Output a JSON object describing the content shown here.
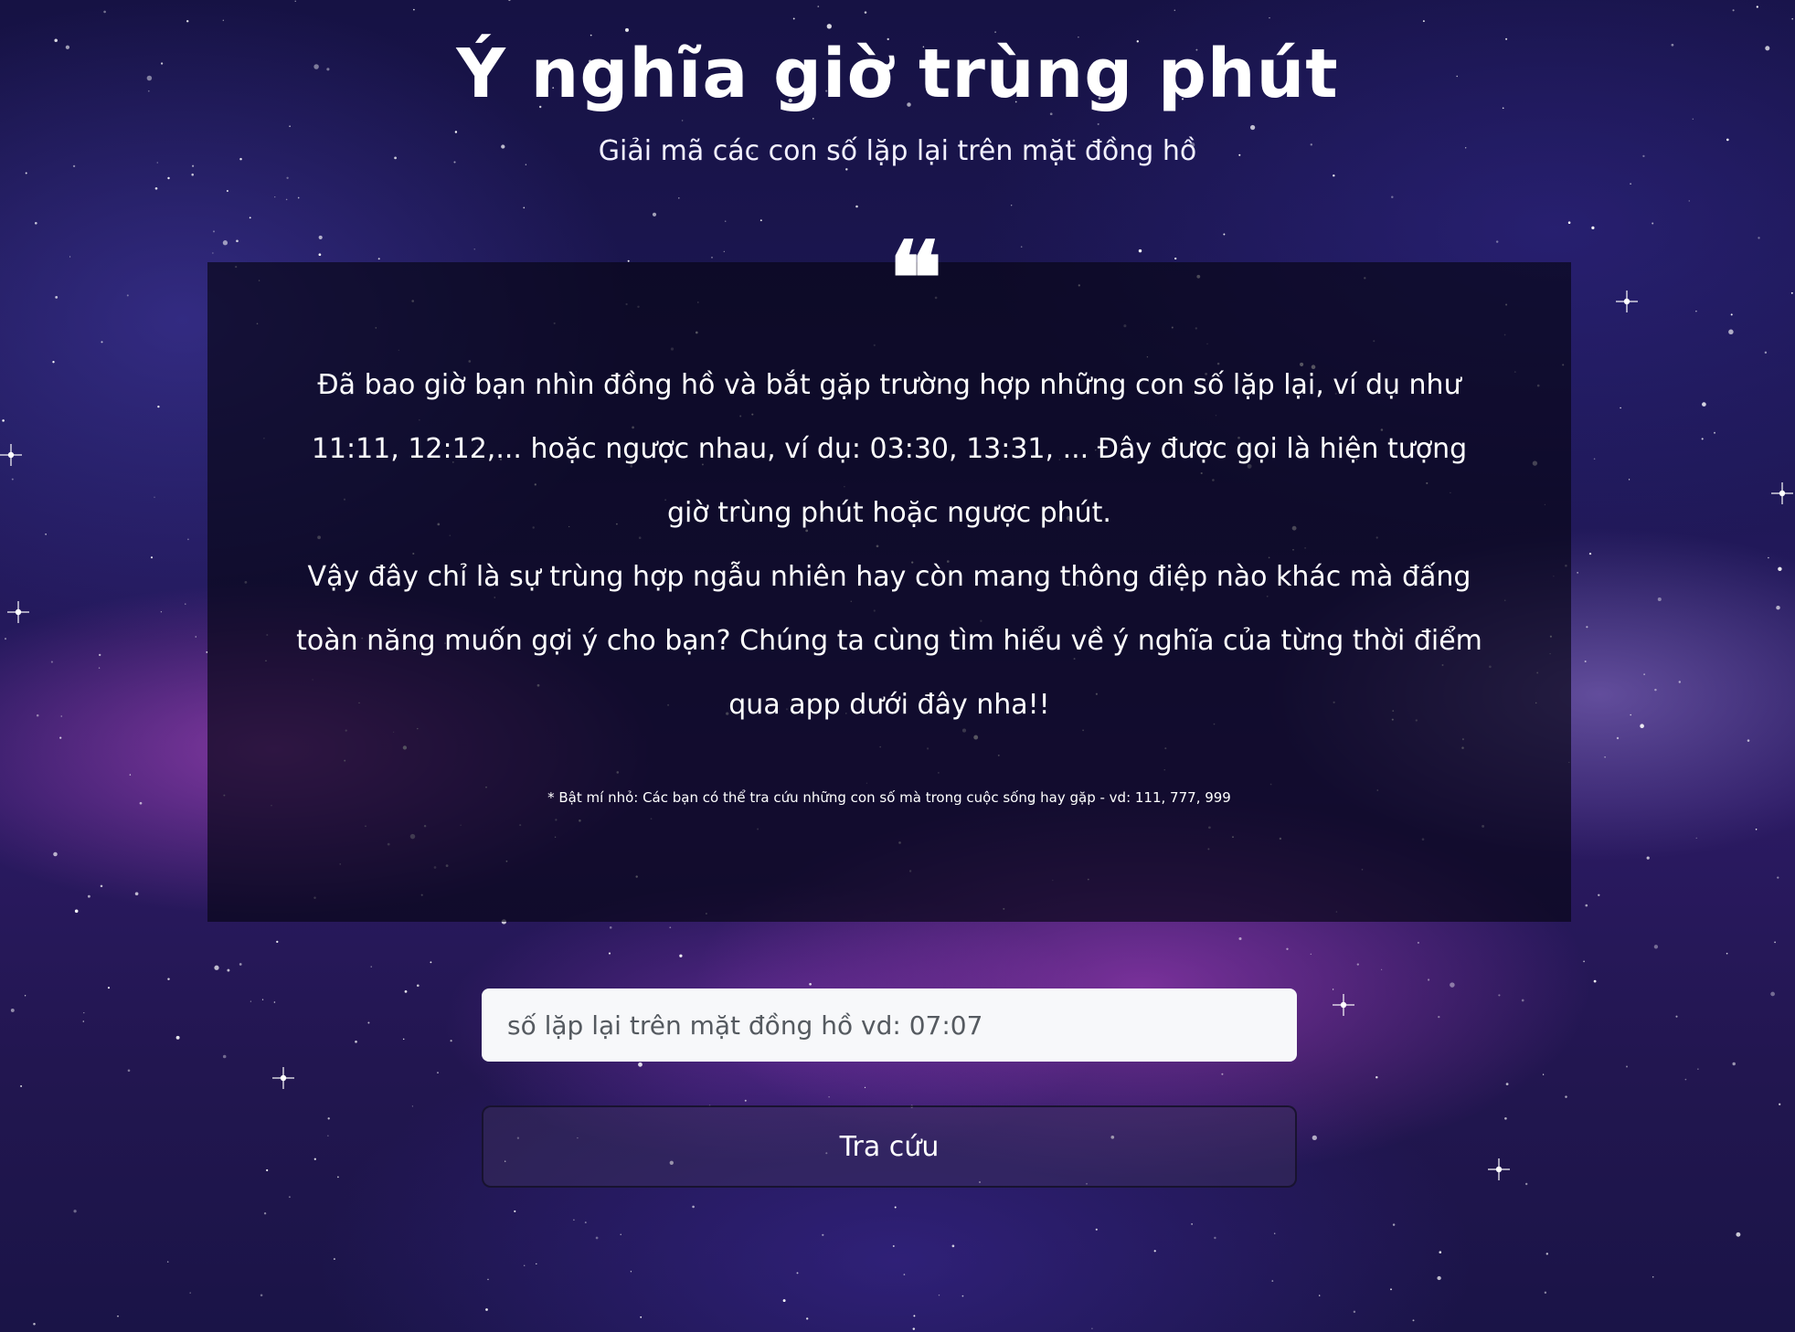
{
  "header": {
    "title": "Ý nghĩa giờ trùng phút",
    "subtitle": "Giải mã các con số lặp lại trên mặt đồng hồ"
  },
  "info_card": {
    "quote_icon": "quote-open-icon",
    "paragraph_1": "Đã bao giờ bạn nhìn đồng hồ và bắt gặp trường hợp những con số lặp lại, ví dụ như 11:11, 12:12,... hoặc ngược nhau, ví dụ: 03:30, 13:31, ... Đây được gọi là hiện tượng giờ trùng phút hoặc ngược phút.",
    "paragraph_2": "Vậy đây chỉ là sự trùng hợp ngẫu nhiên hay còn mang thông điệp nào khác mà đấng toàn năng muốn gợi ý cho bạn? Chúng ta cùng tìm hiểu về ý nghĩa của từng thời điểm qua app dưới đây nha!!",
    "tip": "* Bật mí nhỏ: Các bạn có thể tra cứu những con số mà trong cuộc sống hay gặp - vd: 111, 777, 999"
  },
  "lookup": {
    "input_value": "",
    "input_placeholder": "số lặp lại trên mặt đồng hồ vd: 07:07",
    "button_label": "Tra cứu"
  }
}
